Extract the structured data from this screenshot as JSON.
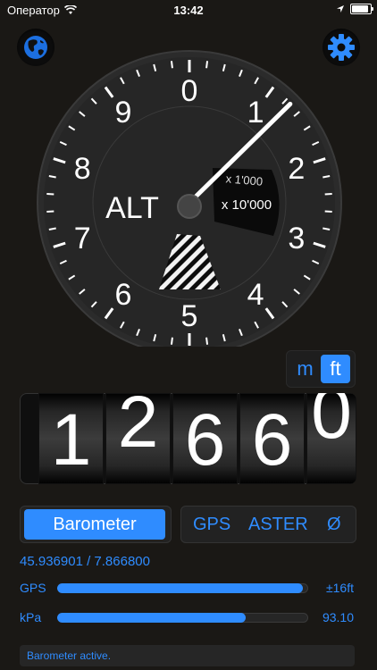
{
  "status_bar": {
    "carrier": "Оператор",
    "time": "13:42"
  },
  "gauge": {
    "label": "ALT",
    "multiplier_a": "x 1'000",
    "multiplier_b": "x 10'000",
    "dial_numbers": [
      "0",
      "1",
      "2",
      "3",
      "4",
      "5",
      "6",
      "7",
      "8",
      "9"
    ],
    "needle_fraction": 0.1266
  },
  "units": {
    "metric": "m",
    "imperial": "ft",
    "selected": "ft"
  },
  "altitude_digits": [
    "1",
    "2",
    "6",
    "6",
    "0"
  ],
  "altitude_value": 12660,
  "source": {
    "barometer": "Barometer",
    "gps": "GPS",
    "aster": "ASTER",
    "none": "Ø",
    "selected": "Barometer"
  },
  "coordinates": "45.936901 / 7.866800",
  "metrics": [
    {
      "label": "GPS",
      "value": "±16ft",
      "level": 0.98
    },
    {
      "label": "kPa",
      "value": "93.10",
      "level": 0.75
    }
  ],
  "status_message": "Barometer active.",
  "colors": {
    "accent": "#2f8cff",
    "background": "#1a1815"
  }
}
